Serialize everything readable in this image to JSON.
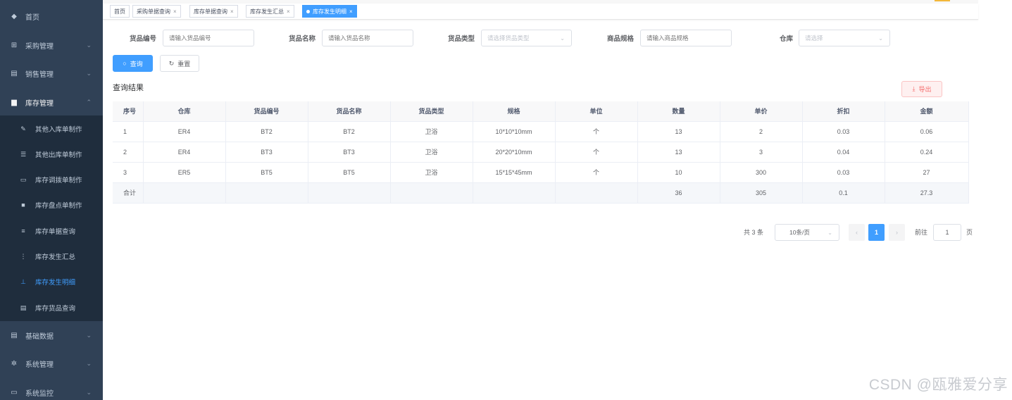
{
  "sidebar": {
    "menu": [
      {
        "label": "首页",
        "icon": "dashboard-icon",
        "glyph": "◆"
      },
      {
        "label": "采购管理",
        "icon": "cart-icon",
        "glyph": "⊞",
        "arrow": "⌄"
      },
      {
        "label": "销售管理",
        "icon": "document-icon",
        "glyph": "▤",
        "arrow": "⌄"
      },
      {
        "label": "库存管理",
        "icon": "folder-icon",
        "glyph": "▆",
        "arrow": "⌃"
      },
      {
        "label": "基础数据",
        "icon": "database-icon",
        "glyph": "▤",
        "arrow": "⌄"
      },
      {
        "label": "系统管理",
        "icon": "gear-icon",
        "glyph": "✲",
        "arrow": "⌄"
      },
      {
        "label": "系统监控",
        "icon": "monitor-icon",
        "glyph": "▭",
        "arrow": "⌄"
      }
    ],
    "submenu": [
      {
        "label": "其他入库单制作",
        "icon": "edit-icon",
        "glyph": "✎"
      },
      {
        "label": "其他出库单制作",
        "icon": "list-icon",
        "glyph": "☰"
      },
      {
        "label": "库存调拨单制作",
        "icon": "monitor-icon",
        "glyph": "▭"
      },
      {
        "label": "库存盘点单制作",
        "icon": "square-icon",
        "glyph": "■"
      },
      {
        "label": "库存单据查询",
        "icon": "list-icon",
        "glyph": "≡"
      },
      {
        "label": "库存发生汇总",
        "icon": "tree-list-icon",
        "glyph": "⋮"
      },
      {
        "label": "库存发生明细",
        "icon": "tree-icon",
        "glyph": "⊥",
        "active": true
      },
      {
        "label": "库存货品查询",
        "icon": "document-icon",
        "glyph": "▤"
      }
    ]
  },
  "tags": [
    {
      "label": "首页",
      "close": ""
    },
    {
      "label": "采购单据查询",
      "close": "×"
    },
    {
      "label": "库存单据查询",
      "close": "×"
    },
    {
      "label": "库存发生汇总",
      "close": "×"
    },
    {
      "label": "库存发生明细",
      "close": "×",
      "active": true
    }
  ],
  "search": {
    "goods_code_label": "货品编号",
    "goods_code_placeholder": "请输入货品编号",
    "goods_name_label": "货品名称",
    "goods_name_placeholder": "请输入货品名称",
    "goods_type_label": "货品类型",
    "goods_type_placeholder": "请选择货品类型",
    "spec_label": "商品规格",
    "spec_placeholder": "请输入商品规格",
    "warehouse_label": "仓库",
    "warehouse_placeholder": "请选择",
    "query_label": "查询",
    "reset_label": "重置",
    "query_icon": "search-icon",
    "reset_icon": "refresh-icon"
  },
  "results": {
    "title": "查询结果",
    "export_label": "导出",
    "export_icon": "download-icon"
  },
  "table": {
    "columns": [
      "序号",
      "仓库",
      "货品编号",
      "货品名称",
      "货品类型",
      "规格",
      "单位",
      "数量",
      "单价",
      "折扣",
      "金额"
    ],
    "rows": [
      [
        "1",
        "ER4",
        "BT2",
        "BT2",
        "卫浴",
        "10*10*10mm",
        "个",
        "13",
        "2",
        "0.03",
        "0.06"
      ],
      [
        "2",
        "ER4",
        "BT3",
        "BT3",
        "卫浴",
        "20*20*10mm",
        "个",
        "13",
        "3",
        "0.04",
        "0.24"
      ],
      [
        "3",
        "ER5",
        "BT5",
        "BT5",
        "卫浴",
        "15*15*45mm",
        "个",
        "10",
        "300",
        "0.03",
        "27"
      ]
    ],
    "summary": [
      "合计",
      "",
      "",
      "",
      "",
      "",
      "",
      "36",
      "305",
      "0.1",
      "27.3"
    ]
  },
  "pagination": {
    "total": "共 3 条",
    "page_size": "10条/页",
    "prev": "‹",
    "current": "1",
    "next": "›",
    "goto_label": "前往",
    "goto_value": "1",
    "page_suffix": "页"
  },
  "watermark": "CSDN @瓯雅爱分享",
  "colors": {
    "sidebar_bg": "#304156",
    "submenu_bg": "#1f2d3d",
    "accent": "#409eff",
    "danger": "#f56c6c"
  }
}
